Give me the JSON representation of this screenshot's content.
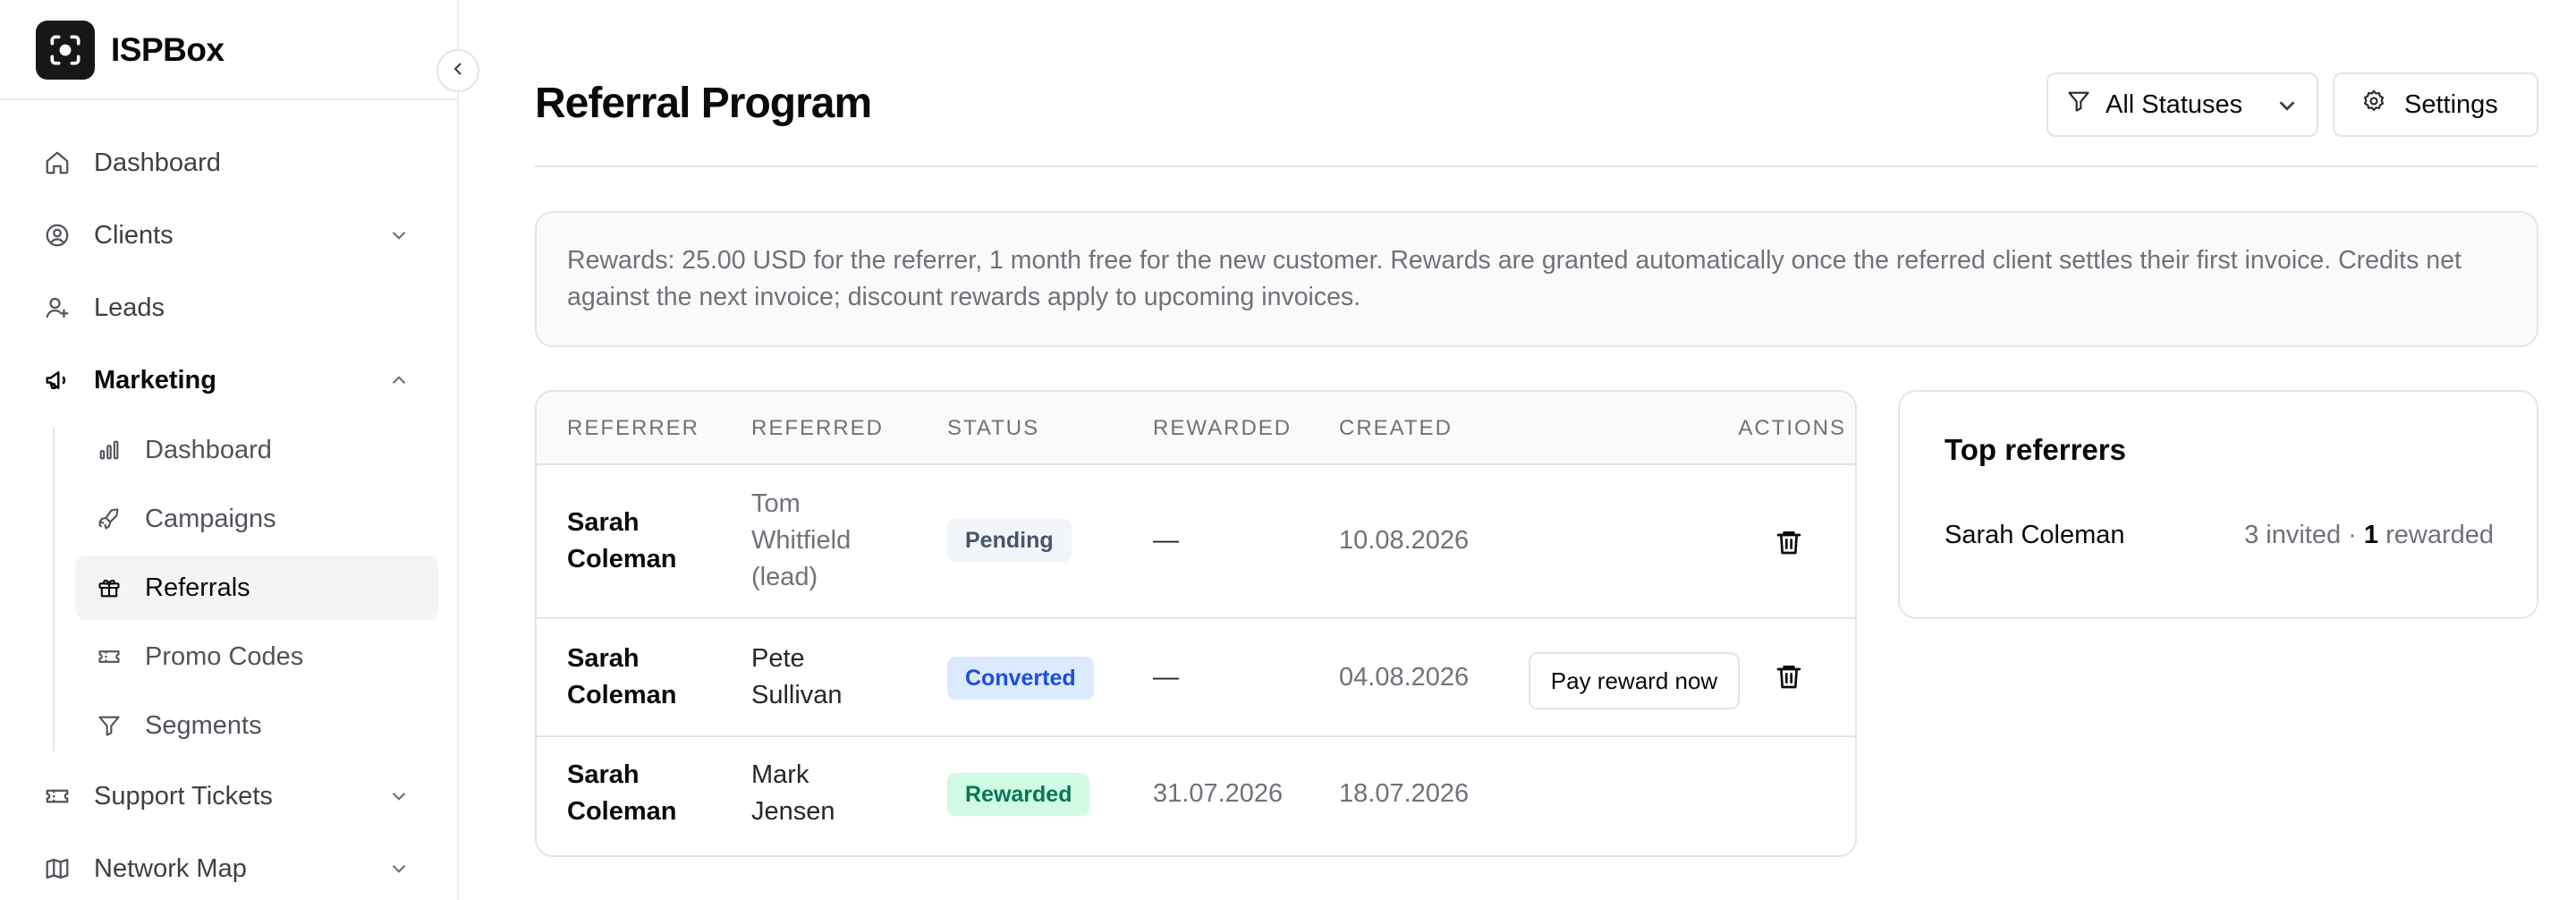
{
  "app": {
    "name": "ISPBox"
  },
  "sidebar": {
    "items": [
      {
        "label": "Dashboard",
        "icon": "home-icon"
      },
      {
        "label": "Clients",
        "icon": "user-circle-icon"
      },
      {
        "label": "Leads",
        "icon": "user-plus-icon"
      },
      {
        "label": "Marketing",
        "icon": "megaphone-icon"
      },
      {
        "label": "Support Tickets",
        "icon": "ticket-icon"
      },
      {
        "label": "Network Map",
        "icon": "map-icon"
      }
    ],
    "marketing_sub": [
      {
        "label": "Dashboard",
        "icon": "bar-chart-icon"
      },
      {
        "label": "Campaigns",
        "icon": "rocket-icon"
      },
      {
        "label": "Referrals",
        "icon": "gift-icon"
      },
      {
        "label": "Promo Codes",
        "icon": "ticket-icon"
      },
      {
        "label": "Segments",
        "icon": "filter-icon"
      }
    ]
  },
  "header": {
    "title": "Referral Program",
    "status_filter": "All Statuses",
    "settings_label": "Settings"
  },
  "notice": {
    "text": "Rewards: 25.00 USD for the referrer, 1 month free for the new customer. Rewards are granted automatically once the referred client settles their first invoice. Credits net against the next invoice; discount rewards apply to upcoming invoices."
  },
  "table": {
    "columns": [
      "REFERRER",
      "REFERRED",
      "STATUS",
      "REWARDED",
      "CREATED",
      "ACTIONS"
    ],
    "rows": [
      {
        "referrer": "Sarah Coleman",
        "referred": "Tom Whitfield (lead)",
        "status": "Pending",
        "rewarded": "—",
        "created": "10.08.2026"
      },
      {
        "referrer": "Sarah Coleman",
        "referred": "Pete Sullivan",
        "status": "Converted",
        "rewarded": "—",
        "created": "04.08.2026",
        "action_label": "Pay reward now"
      },
      {
        "referrer": "Sarah Coleman",
        "referred": "Mark Jensen",
        "status": "Rewarded",
        "rewarded": "31.07.2026",
        "created": "18.07.2026"
      }
    ]
  },
  "top_referrers": {
    "title": "Top referrers",
    "items": [
      {
        "name": "Sarah Coleman",
        "invited": "3 invited · ",
        "rewarded_count": "1",
        "rewarded_suffix": " rewarded"
      }
    ]
  },
  "colors": {
    "pending_bg": "#f1f5f9",
    "converted_bg": "#dbeafe",
    "rewarded_bg": "#d1fae5"
  }
}
